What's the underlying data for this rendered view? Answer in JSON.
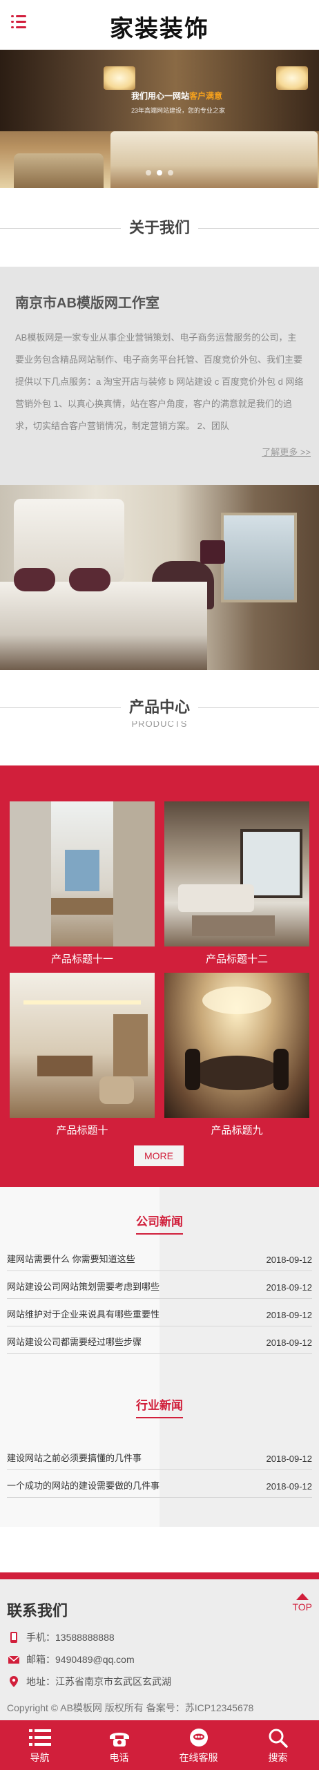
{
  "header": {
    "title": "家装装饰",
    "menu_icon": "hamburger-menu-icon"
  },
  "banner": {
    "slogan_prefix": "我们用心一网站",
    "slogan_highlight": "客户满意",
    "slogan_sub": "23年高端网站建设，您的专业之家",
    "slide_count": 3,
    "active_slide": 2
  },
  "about": {
    "heading": "关于我们",
    "company": "南京市AB模版网工作室",
    "description": "AB模板网是一家专业从事企业营销策划、电子商务运营服务的公司，主要业务包含精品网站制作、电子商务平台托管、百度竞价外包、我们主要提供以下几点服务：a 淘宝开店与装修 b 网站建设 c 百度竞价外包 d 网络营销外包 1、以真心换真情，站在客户角度，客户的满意就是我们的追求，切实结合客户营销情况，制定营销方案。 2、团队",
    "more": "了解更多 >>"
  },
  "products": {
    "heading": "产品中心",
    "subheading": "PRODUCTS",
    "items": [
      {
        "title": "产品标题十一"
      },
      {
        "title": "产品标题十二"
      },
      {
        "title": "产品标题十"
      },
      {
        "title": "产品标题九"
      }
    ],
    "more": "MORE"
  },
  "company_news": {
    "heading": "公司新闻",
    "items": [
      {
        "title": "建网站需要什么 你需要知道这些",
        "date": "2018-09-12"
      },
      {
        "title": "网站建设公司网站策划需要考虑到哪些",
        "date": "2018-09-12"
      },
      {
        "title": "网站维护对于企业来说具有哪些重要性",
        "date": "2018-09-12"
      },
      {
        "title": "网站建设公司都需要经过哪些步骤",
        "date": "2018-09-12"
      }
    ]
  },
  "industry_news": {
    "heading": "行业新闻",
    "items": [
      {
        "title": "建设网站之前必须要搞懂的几件事",
        "date": "2018-09-12"
      },
      {
        "title": "一个成功的网站的建设需要做的几件事",
        "date": "2018-09-12"
      }
    ]
  },
  "contact": {
    "heading": "联系我们",
    "top": "TOP",
    "phone": "手机：13588888888",
    "email": "邮箱：9490489@qq.com",
    "address": "地址：江苏省南京市玄武区玄武湖",
    "copyright": "Copyright © AB模板网 版权所有 备案号：苏ICP12345678"
  },
  "footer_nav": [
    {
      "label": "导航",
      "icon": "list-icon"
    },
    {
      "label": "电话",
      "icon": "phone-icon"
    },
    {
      "label": "在线客服",
      "icon": "chat-icon"
    },
    {
      "label": "搜索",
      "icon": "search-icon"
    }
  ],
  "colors": {
    "accent": "#d11f3b",
    "about_bg": "#e5e5e5",
    "contact_bg": "#ededed"
  }
}
